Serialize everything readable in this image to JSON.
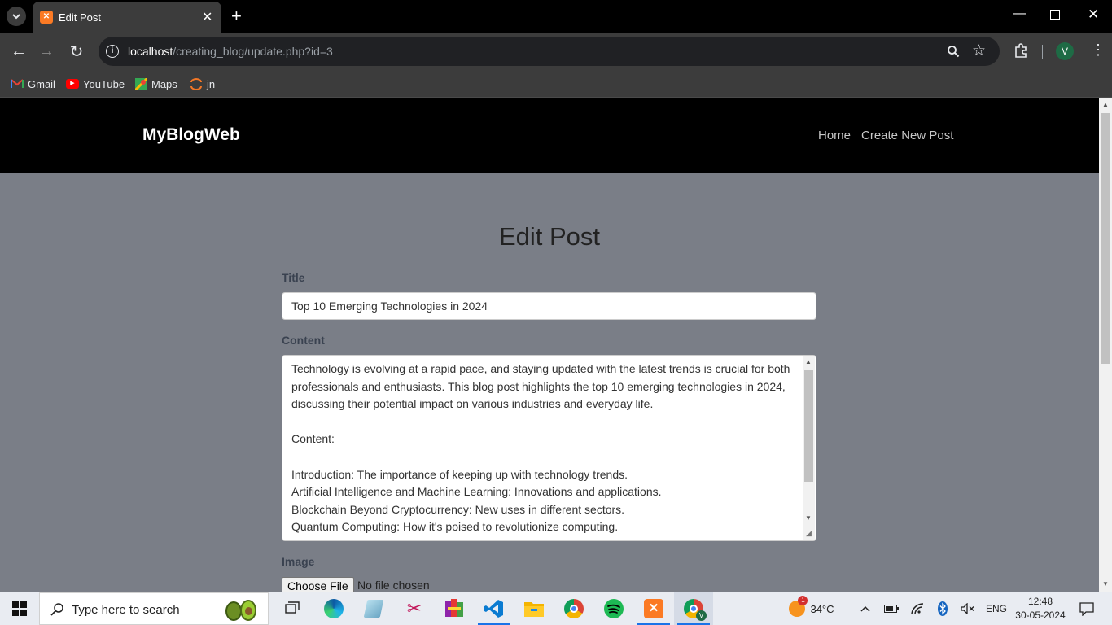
{
  "browser": {
    "tab_title": "Edit Post",
    "url_host": "localhost",
    "url_path": "/creating_blog/update.php?id=3",
    "profile_initial": "V",
    "bookmarks": [
      {
        "label": "Gmail",
        "icon": "gmail-icon"
      },
      {
        "label": "YouTube",
        "icon": "youtube-icon"
      },
      {
        "label": "Maps",
        "icon": "maps-icon"
      },
      {
        "label": "jn",
        "icon": "jupyter-icon"
      }
    ]
  },
  "site": {
    "brand": "MyBlogWeb",
    "nav": [
      "Home",
      "Create New Post"
    ]
  },
  "form": {
    "heading": "Edit Post",
    "title_label": "Title",
    "title_value": "Top 10 Emerging Technologies in 2024",
    "content_label": "Content",
    "content_value": "Technology is evolving at a rapid pace, and staying updated with the latest trends is crucial for both professionals and enthusiasts. This blog post highlights the top 10 emerging technologies in 2024, discussing their potential impact on various industries and everyday life.\n\nContent:\n\nIntroduction: The importance of keeping up with technology trends.\nArtificial Intelligence and Machine Learning: Innovations and applications.\nBlockchain Beyond Cryptocurrency: New uses in different sectors.\nQuantum Computing: How it's poised to revolutionize computing.",
    "image_label": "Image",
    "file_button": "Choose File",
    "file_status": "No file chosen"
  },
  "taskbar": {
    "search_placeholder": "Type here to search",
    "weather_temp": "34°C",
    "weather_badge": "1",
    "language": "ENG",
    "time": "12:48",
    "date": "30-05-2024"
  },
  "colors": {
    "page_bg": "#7a7e87",
    "navbar_bg": "#000000",
    "chrome_bg": "#3c3c3c"
  }
}
